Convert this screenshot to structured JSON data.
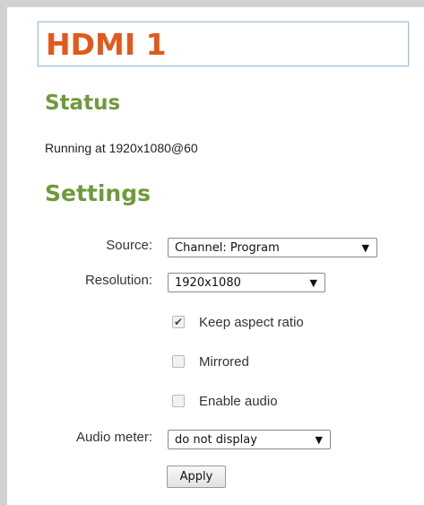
{
  "title_input": {
    "value": "HDMI 1"
  },
  "status": {
    "heading": "Status",
    "text": "Running at 1920x1080@60"
  },
  "settings": {
    "heading": "Settings",
    "source": {
      "label": "Source:",
      "selected": "Channel: Program"
    },
    "resolution": {
      "label": "Resolution:",
      "selected": "1920x1080"
    },
    "keep_aspect": {
      "label": "Keep aspect ratio",
      "checked": true
    },
    "mirrored": {
      "label": "Mirrored",
      "checked": false
    },
    "enable_audio": {
      "label": "Enable audio",
      "checked": false
    },
    "audio_meter": {
      "label": "Audio meter:",
      "selected": "do not display"
    },
    "apply_label": "Apply"
  },
  "colors": {
    "title": "#e05a1c",
    "heading": "#6f9a3a",
    "input_border": "#9fbbd6"
  },
  "icons": {
    "dropdown": "triangle-down",
    "check": "checkmark"
  }
}
